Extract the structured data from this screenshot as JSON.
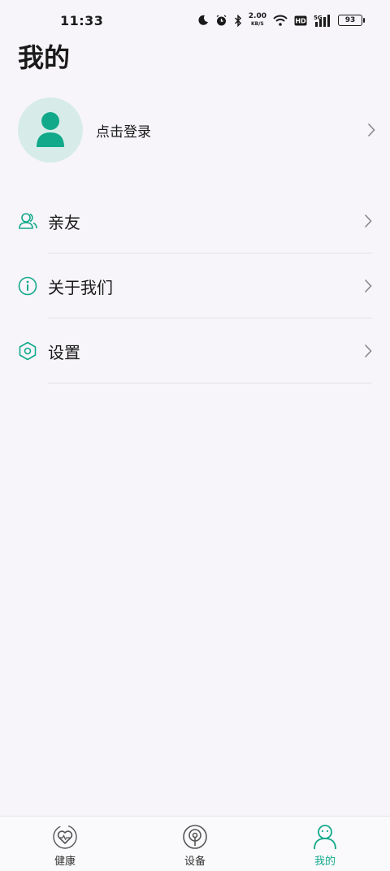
{
  "status_bar": {
    "time": "11:33",
    "net_speed": "2.00",
    "net_unit": "KB/S",
    "signal_label": "5G",
    "hd_label": "HD",
    "battery": "93"
  },
  "page": {
    "title": "我的"
  },
  "profile": {
    "login_label": "点击登录"
  },
  "menu": {
    "items": [
      {
        "label": "亲友",
        "icon": "friends-icon"
      },
      {
        "label": "关于我们",
        "icon": "info-icon"
      },
      {
        "label": "设置",
        "icon": "settings-icon"
      }
    ]
  },
  "tabbar": {
    "tabs": [
      {
        "label": "健康",
        "icon": "health-icon",
        "active": false
      },
      {
        "label": "设备",
        "icon": "device-icon",
        "active": false
      },
      {
        "label": "我的",
        "icon": "me-icon",
        "active": true
      }
    ]
  },
  "colors": {
    "accent": "#12a98a",
    "background": "#f7f5fa",
    "avatar_bg": "#d7ece9"
  }
}
